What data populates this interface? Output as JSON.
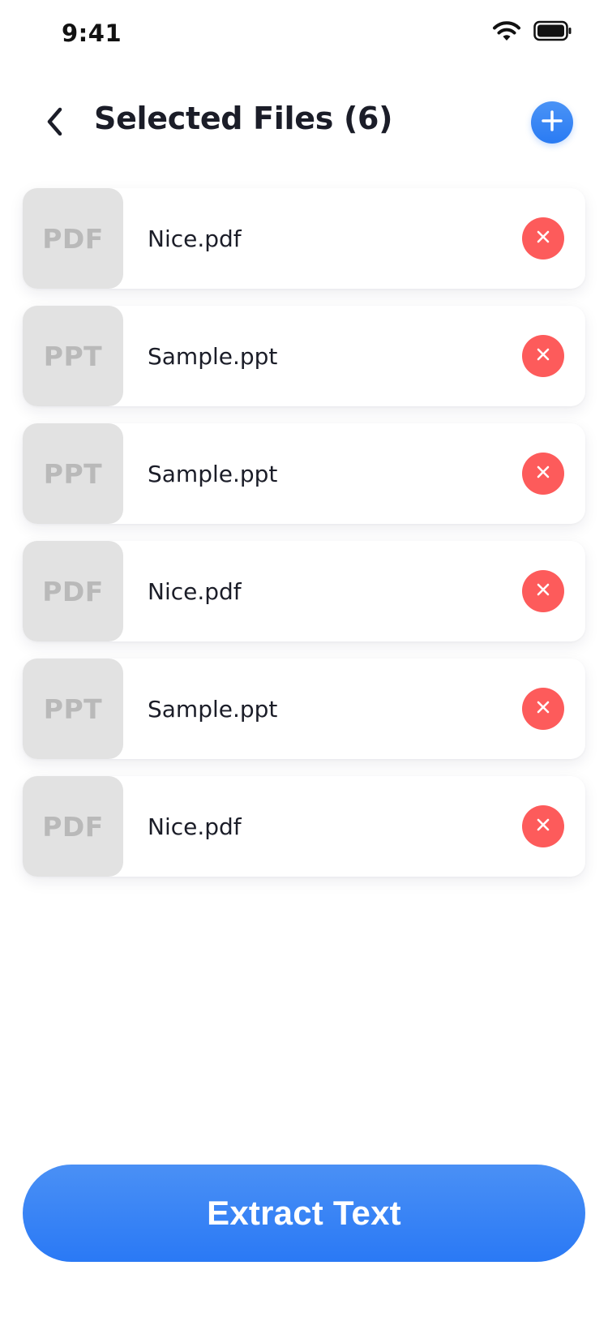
{
  "status_bar": {
    "time": "9:41",
    "icons": [
      "wifi-icon",
      "battery-icon"
    ]
  },
  "header": {
    "title": "Selected Files (6)",
    "back_icon": "chevron-left-icon",
    "add_icon": "plus-icon"
  },
  "colors": {
    "accent": "#2a7bf3",
    "remove": "#fd5b5b",
    "thumb_bg": "#e2e2e2",
    "thumb_text": "#b9b9b9",
    "text": "#1b1d28"
  },
  "files": [
    {
      "type": "PDF",
      "name": "Nice.pdf"
    },
    {
      "type": "PPT",
      "name": "Sample.ppt"
    },
    {
      "type": "PPT",
      "name": "Sample.ppt"
    },
    {
      "type": "PDF",
      "name": "Nice.pdf"
    },
    {
      "type": "PPT",
      "name": "Sample.ppt"
    },
    {
      "type": "PDF",
      "name": "Nice.pdf"
    }
  ],
  "actions": {
    "extract_label": "Extract Text"
  }
}
